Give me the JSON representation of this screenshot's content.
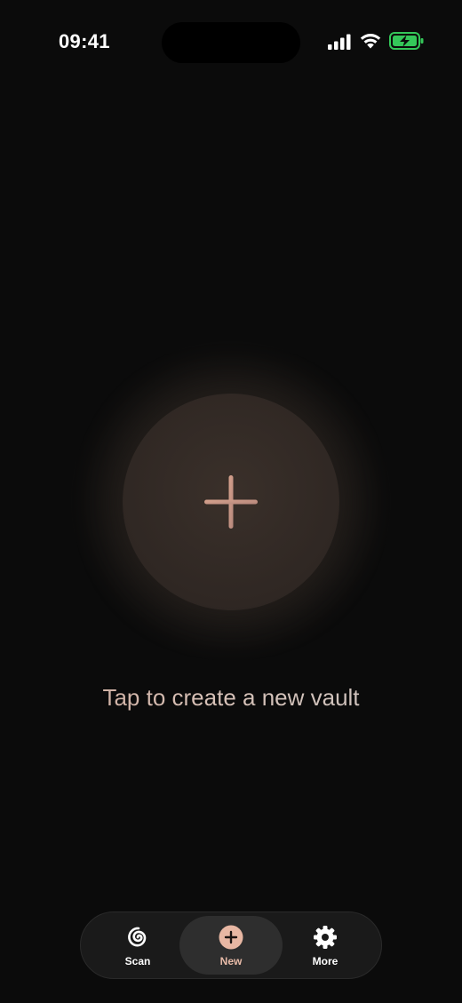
{
  "status_bar": {
    "time": "09:41",
    "icons": [
      "signal-icon",
      "wifi-icon",
      "battery-charging-icon"
    ],
    "battery_color": "#34c759"
  },
  "main": {
    "create_icon": "plus-icon",
    "caption": "Tap to create a new vault",
    "accent_color": "#c9968a"
  },
  "tab_bar": {
    "tabs": [
      {
        "label": "Scan",
        "icon": "spiral-icon",
        "selected": false
      },
      {
        "label": "New",
        "icon": "plus-circle-icon",
        "selected": true
      },
      {
        "label": "More",
        "icon": "gear-icon",
        "selected": false
      }
    ]
  }
}
